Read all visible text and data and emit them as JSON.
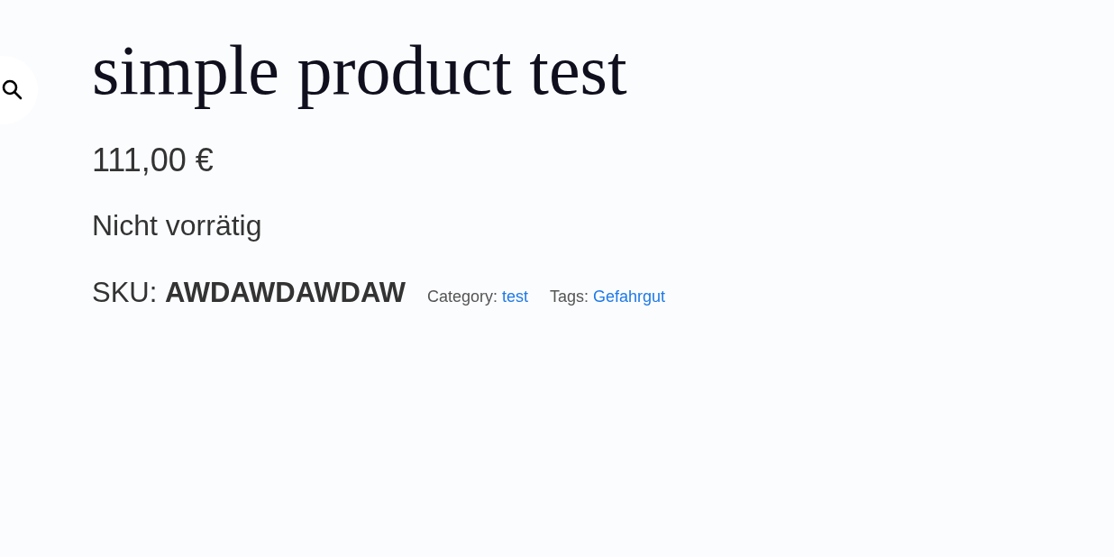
{
  "title": "simple product test",
  "price": "111,00 €",
  "stock": "Nicht vorrätig",
  "sku": {
    "label": "SKU:",
    "value": "AWDAWDAWDAW"
  },
  "meta": [
    {
      "label": "Category:",
      "link": "test"
    },
    {
      "label": "Tags:",
      "link": "Gefahrgut"
    }
  ]
}
